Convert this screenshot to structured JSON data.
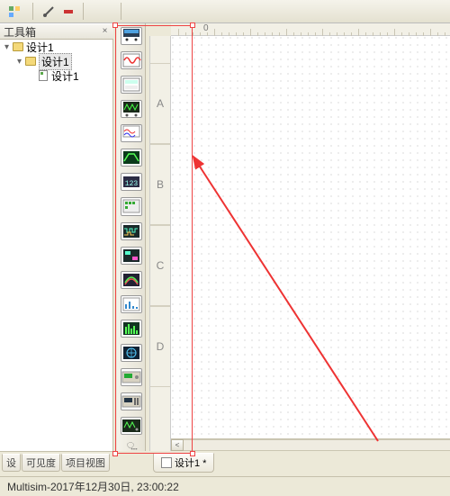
{
  "panel": {
    "title": "工具箱",
    "close": "×"
  },
  "tree": {
    "root": "设计1",
    "child1": "设计1",
    "child2": "设计1"
  },
  "tree_tabs": [
    "设",
    "可见度",
    "项目视图"
  ],
  "ruler_v": {
    "A": "A",
    "B": "B",
    "C": "C",
    "D": "D"
  },
  "ruler_h": {
    "zero": "0"
  },
  "bottom_tab": {
    "label": "设计1 *"
  },
  "status": {
    "app": "Multisim",
    "sep": " - ",
    "time": "2017年12月30日, 23:00:22"
  },
  "instr_icons": [
    "multimeter",
    "func-gen",
    "wattmeter",
    "two-ch-scope",
    "four-ch-scope",
    "bode",
    "counter",
    "word-gen",
    "logic-analyzer",
    "logic-conv",
    "iv",
    "distortion",
    "spectrum",
    "network",
    "agilent-fg",
    "agilent-mm",
    "agilent-scope"
  ]
}
